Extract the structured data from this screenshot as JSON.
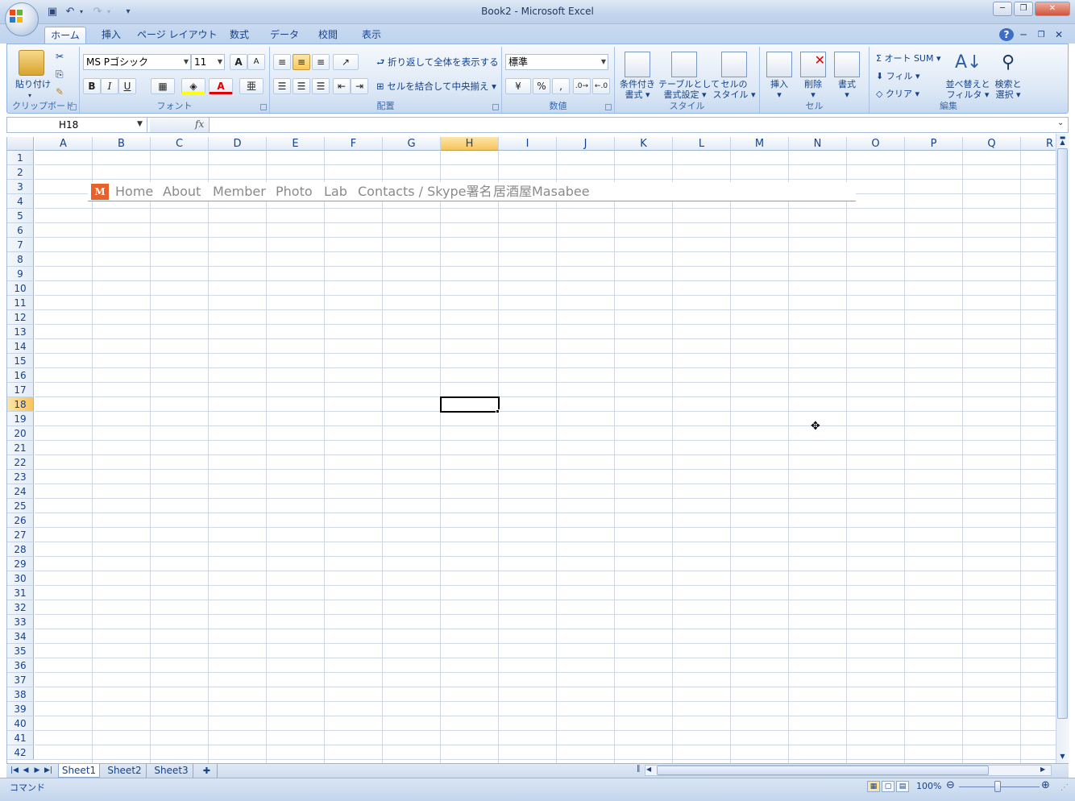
{
  "window": {
    "title": "Book2 - Microsoft Excel"
  },
  "qat": {
    "save": "save-icon",
    "undo": "undo-icon",
    "redo": "redo-icon",
    "customize": "▾"
  },
  "tabs": [
    "ホーム",
    "挿入",
    "ページ レイアウト",
    "数式",
    "データ",
    "校閲",
    "表示"
  ],
  "ribbon": {
    "clipboard": {
      "label": "クリップボード",
      "paste": "貼り付け"
    },
    "font": {
      "label": "フォント",
      "name": "MS Pゴシック",
      "size": "11",
      "bold": "B",
      "italic": "I",
      "underline": "U"
    },
    "alignment": {
      "label": "配置",
      "wrap": "折り返して全体を表示する",
      "merge": "セルを結合して中央揃え"
    },
    "number": {
      "label": "数値",
      "format": "標準",
      "percent": "%",
      "comma": ","
    },
    "styles": {
      "label": "スタイル",
      "cond1": "条件付き",
      "cond2": "書式",
      "table1": "テーブルとして",
      "table2": "書式設定",
      "cell1": "セルの",
      "cell2": "スタイル"
    },
    "cells": {
      "label": "セル",
      "insert": "挿入",
      "delete": "削除",
      "format": "書式"
    },
    "editing": {
      "label": "編集",
      "autosum": "オート SUM",
      "fill": "フィル",
      "clear": "クリア",
      "sort1": "並べ替えと",
      "sort2": "フィルタ",
      "find1": "検索と",
      "find2": "選択"
    }
  },
  "formula": {
    "namebox": "H18",
    "fx": "fx",
    "value": ""
  },
  "columns": [
    "A",
    "B",
    "C",
    "D",
    "E",
    "F",
    "G",
    "H",
    "I",
    "J",
    "K",
    "L",
    "M",
    "N",
    "O",
    "P",
    "Q",
    "R"
  ],
  "selected_column": "H",
  "rows": [
    "1",
    "2",
    "3",
    "4",
    "5",
    "6",
    "7",
    "8",
    "9",
    "10",
    "11",
    "12",
    "13",
    "14",
    "15",
    "16",
    "17",
    "18",
    "19",
    "20",
    "21",
    "22",
    "23",
    "24",
    "25",
    "26",
    "27",
    "28",
    "29",
    "30",
    "31",
    "32",
    "33",
    "34",
    "35",
    "36",
    "37",
    "38",
    "39",
    "40",
    "41",
    "42"
  ],
  "selected_row": "18",
  "webnav": {
    "logo": "M",
    "links": [
      "Home",
      "About",
      "Member",
      "Photo",
      "Lab",
      "Contacts / Skype署名",
      "居酒屋Masabee"
    ]
  },
  "sheets": [
    "Sheet1",
    "Sheet2",
    "Sheet3"
  ],
  "active_sheet": "Sheet1",
  "status": {
    "mode": "コマンド",
    "zoom": "100%"
  },
  "colors": {
    "accent": "#f8c35e",
    "ribbon": "#dbe7f5",
    "logo": "#e8612a"
  }
}
